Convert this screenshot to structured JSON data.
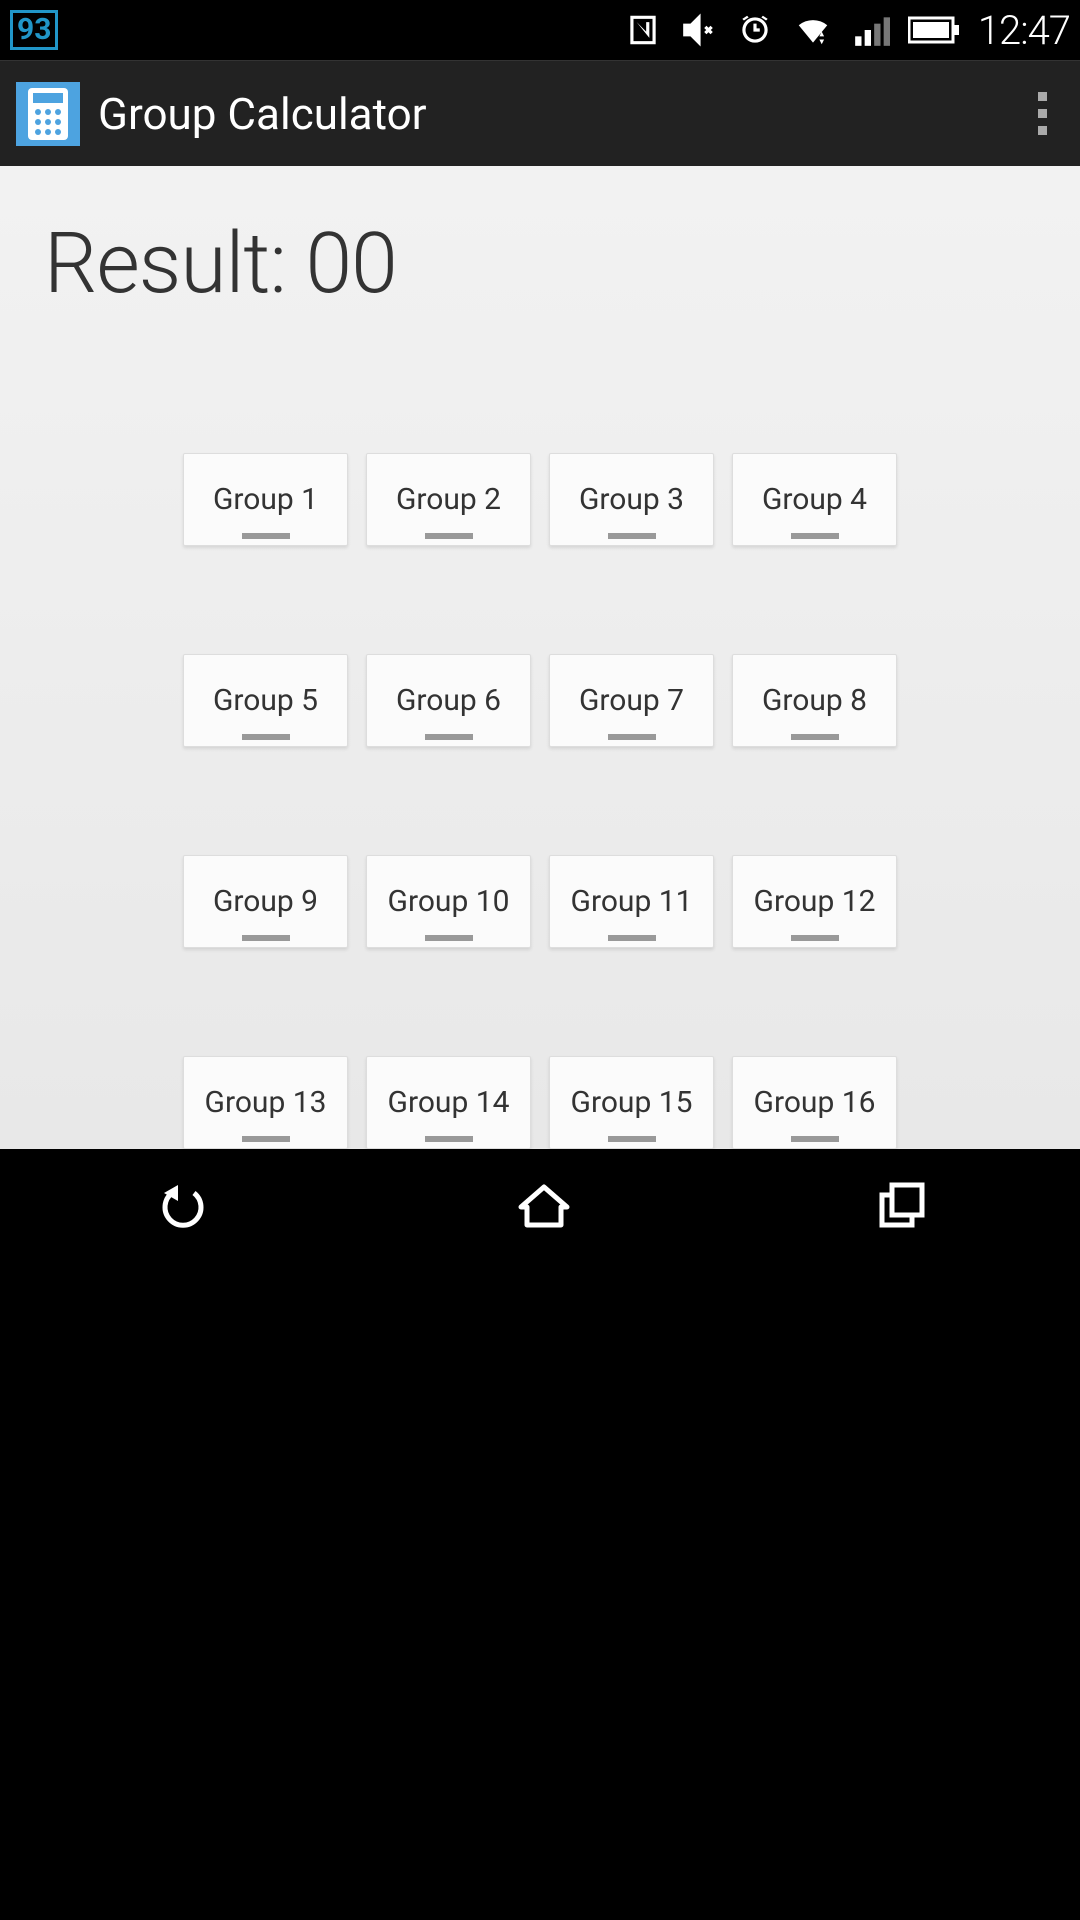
{
  "status": {
    "battery_pct": "93",
    "time": "12:47"
  },
  "app": {
    "title": "Group Calculator"
  },
  "result": {
    "label": "Result:",
    "value": "00"
  },
  "groups": [
    {
      "label": "Group 1"
    },
    {
      "label": "Group 2"
    },
    {
      "label": "Group 3"
    },
    {
      "label": "Group 4"
    },
    {
      "label": "Group 5"
    },
    {
      "label": "Group 6"
    },
    {
      "label": "Group 7"
    },
    {
      "label": "Group 8"
    },
    {
      "label": "Group 9"
    },
    {
      "label": "Group 10"
    },
    {
      "label": "Group 11"
    },
    {
      "label": "Group 12"
    },
    {
      "label": "Group 13"
    },
    {
      "label": "Group 14"
    },
    {
      "label": "Group 15"
    },
    {
      "label": "Group 16"
    }
  ]
}
